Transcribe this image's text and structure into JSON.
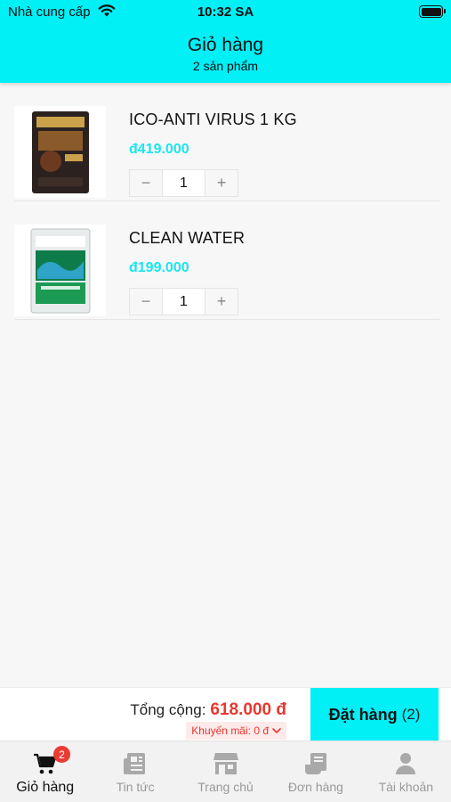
{
  "status_bar": {
    "carrier": "Nhà cung cấp",
    "time": "10:32 SA"
  },
  "header": {
    "title": "Giỏ hàng",
    "subtitle": "2 sản phẩm"
  },
  "cart": {
    "items": [
      {
        "name": "ICO-ANTI VIRUS 1 KG",
        "price": "đ419.000",
        "quantity": "1",
        "decrement": "−",
        "increment": "+"
      },
      {
        "name": "CLEAN WATER",
        "price": "đ199.000",
        "quantity": "1",
        "decrement": "−",
        "increment": "+"
      }
    ]
  },
  "checkout": {
    "total_label": "Tổng cộng:",
    "total_value": "618.000 đ",
    "promo_label": "Khuyến mãi: 0 đ",
    "order_label": "Đặt hàng",
    "order_count": "(2)"
  },
  "tabbar": {
    "cart_badge": "2",
    "tabs": [
      {
        "label": "Giỏ hàng",
        "icon": "cart-icon",
        "active": true
      },
      {
        "label": "Tin tức",
        "icon": "news-icon",
        "active": false
      },
      {
        "label": "Trang chủ",
        "icon": "store-icon",
        "active": false
      },
      {
        "label": "Đơn hàng",
        "icon": "orders-icon",
        "active": false
      },
      {
        "label": "Tài khoản",
        "icon": "account-icon",
        "active": false
      }
    ]
  },
  "colors": {
    "accent": "#00f0f6",
    "price": "#19e6ee",
    "total": "#e8372e",
    "badge": "#ea3b34"
  }
}
